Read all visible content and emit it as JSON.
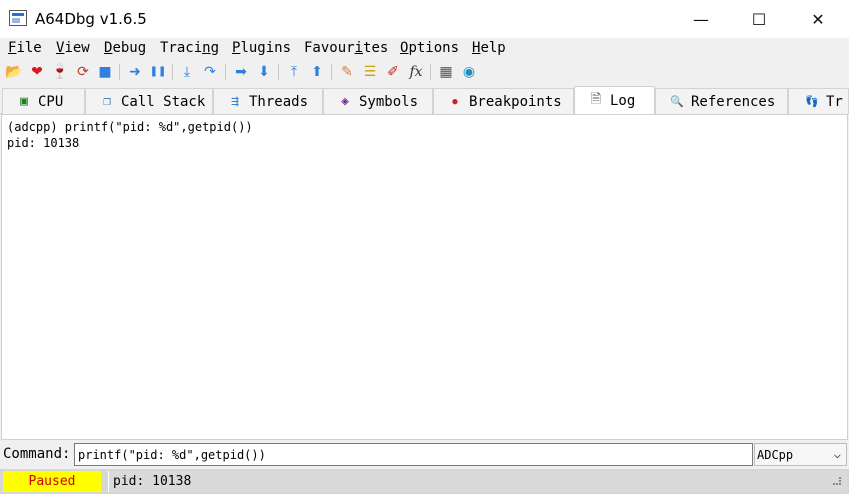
{
  "window": {
    "title": "A64Dbg v1.6.5",
    "controls": {
      "minimize": "—",
      "maximize": "☐",
      "close": "✕"
    }
  },
  "menu": [
    {
      "pre": "",
      "u": "F",
      "post": "ile"
    },
    {
      "pre": "",
      "u": "V",
      "post": "iew"
    },
    {
      "pre": "",
      "u": "D",
      "post": "ebug"
    },
    {
      "pre": "Traci",
      "u": "n",
      "post": "g"
    },
    {
      "pre": "",
      "u": "P",
      "post": "lugins"
    },
    {
      "pre": "Favour",
      "u": "i",
      "post": "tes"
    },
    {
      "pre": "",
      "u": "O",
      "post": "ptions"
    },
    {
      "pre": "",
      "u": "H",
      "post": "elp"
    }
  ],
  "toolbar": [
    {
      "name": "open-icon",
      "glyph": "📂"
    },
    {
      "name": "attach-heart-icon",
      "glyph": "❤"
    },
    {
      "name": "detach-glass-icon",
      "glyph": "🍷"
    },
    {
      "name": "restart-icon",
      "glyph": "⟳"
    },
    {
      "name": "stop-icon",
      "glyph": "■"
    },
    {
      "name": "run-arrow-icon",
      "glyph": "➜"
    },
    {
      "name": "pause-icon",
      "glyph": "❚❚"
    },
    {
      "name": "step-into-icon",
      "glyph": "⤓"
    },
    {
      "name": "step-over-icon",
      "glyph": "↷"
    },
    {
      "name": "run-to-user-icon",
      "glyph": "➡"
    },
    {
      "name": "step-down-icon",
      "glyph": "⬇"
    },
    {
      "name": "execute-till-return-icon",
      "glyph": "⤒"
    },
    {
      "name": "step-up-icon",
      "glyph": "⬆"
    },
    {
      "name": "patch-icon",
      "glyph": "✎"
    },
    {
      "name": "comments-icon",
      "glyph": "☰"
    },
    {
      "name": "highlight-icon",
      "glyph": "✐"
    },
    {
      "name": "function-fx-icon",
      "glyph": "fx"
    },
    {
      "name": "calculator-icon",
      "glyph": "▦"
    },
    {
      "name": "globe-icon",
      "glyph": "◉"
    }
  ],
  "tabs": [
    {
      "name": "tab-cpu",
      "label": "CPU",
      "icon": "cpu-chip-icon",
      "glyph": "▣",
      "color": "#1e7d1e"
    },
    {
      "name": "tab-call-stack",
      "label": "Call Stack",
      "icon": "call-stack-icon",
      "glyph": "❐",
      "color": "#3b6fb6"
    },
    {
      "name": "tab-threads",
      "label": "Threads",
      "icon": "threads-icon",
      "glyph": "⇶",
      "color": "#3a7fd0"
    },
    {
      "name": "tab-symbols",
      "label": "Symbols",
      "icon": "symbols-icon",
      "glyph": "◈",
      "color": "#7a2a8a"
    },
    {
      "name": "tab-breakpoints",
      "label": "Breakpoints",
      "icon": "breakpoint-dot-icon",
      "glyph": "●",
      "color": "#d21f1f"
    },
    {
      "name": "tab-log",
      "label": "Log",
      "icon": "log-page-icon",
      "glyph": "🗎",
      "color": "#555555"
    },
    {
      "name": "tab-references",
      "label": "References",
      "icon": "magnifier-icon",
      "glyph": "🔍",
      "color": "#555555"
    },
    {
      "name": "tab-trace",
      "label": "Tr",
      "icon": "trace-footsteps-icon",
      "glyph": "👣",
      "color": "#333333"
    }
  ],
  "log": {
    "lines": [
      "(adcpp) printf(\"pid: %d\",getpid())",
      "pid: 10138"
    ]
  },
  "command": {
    "label": "Command:",
    "value": "printf(\"pid: %d\",getpid())",
    "mode": "ADCpp"
  },
  "status": {
    "state": "Paused",
    "message": "pid: 10138"
  }
}
